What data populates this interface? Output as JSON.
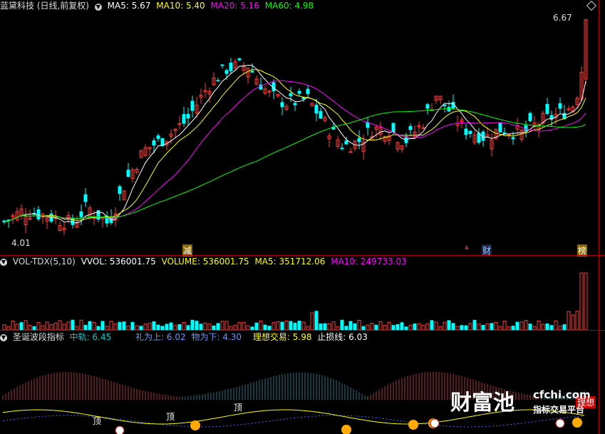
{
  "colors": {
    "up": "#ff3c3c",
    "down": "#00ffff",
    "ma5": "#ffffff",
    "ma10": "#ffff00",
    "ma20": "#ff00ff",
    "ma60": "#00ff00",
    "border": "#b00000"
  },
  "main": {
    "title": "蓝黛科技 (日线,前复权)",
    "ma5": "MA5: 5.67",
    "ma10": "MA10: 5.40",
    "ma20": "MA20: 5.16",
    "ma60": "MA60: 4.98",
    "high_label": "6.67",
    "low_label": "4.01",
    "markers": {
      "jian": "减",
      "cai": "财",
      "bang": "榜"
    }
  },
  "volume": {
    "title": "VOL-TDX(5,10)",
    "vvol": "VVOL: 536001.75",
    "volume": "VOLUME: 536001.75",
    "ma5": "MA5: 351712.06",
    "ma10": "MA10: 249733.03"
  },
  "indicator": {
    "title": "圣诞波段指标",
    "zhonggui": "中轨: 6.45",
    "liweishang": "礼为上: 6.02",
    "wuweixia": "物为下: 4.30",
    "lixiang": "理想交易: 5.98",
    "zhisun": "止损线: 6.03",
    "top_labels": [
      "顶",
      "顶",
      "顶"
    ],
    "deal_label": "理想"
  },
  "watermark": {
    "brand": "财富池",
    "site": "cfchi.com",
    "sub": "指标交易平台"
  }
}
